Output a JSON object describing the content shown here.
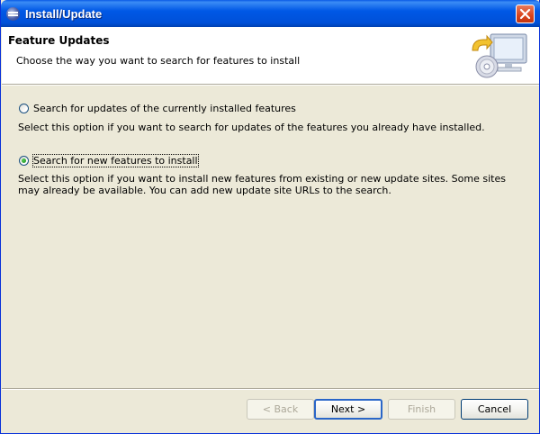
{
  "window": {
    "title": "Install/Update"
  },
  "header": {
    "title": "Feature Updates",
    "description": "Choose the way you want to search for features to install"
  },
  "options": [
    {
      "label": "Search for updates of the currently installed features",
      "description": "Select this option if you want to search for updates of the features you already have installed.",
      "selected": false
    },
    {
      "label": "Search for new features to install",
      "description": "Select this option if you want to install new features from existing or new update sites. Some sites may already be available. You can add new update site URLs to the search.",
      "selected": true
    }
  ],
  "buttons": {
    "back": "< Back",
    "next": "Next >",
    "finish": "Finish",
    "cancel": "Cancel"
  },
  "icons": {
    "title": "eclipse-icon",
    "close": "close-icon",
    "wizard": "install-update-wizard-icon"
  },
  "colors": {
    "titlebar": "#0058e6",
    "dialog_bg": "#ece9d8",
    "header_bg": "#ffffff",
    "close_button": "#d9431c"
  }
}
